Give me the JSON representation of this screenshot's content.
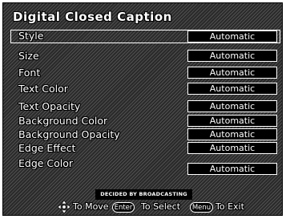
{
  "title": "Digital Closed Caption",
  "style_row": {
    "label": "Style",
    "value": "Automatic"
  },
  "settings": [
    {
      "label": "Size",
      "value": "Automatic"
    },
    {
      "label": "Font",
      "value": "Automatic"
    },
    {
      "label": "Text Color",
      "value": "Automatic"
    },
    {
      "label": "Text Opacity",
      "value": "Automatic"
    },
    {
      "label": "Background Color",
      "value": "Automatic"
    },
    {
      "label": "Background Opacity",
      "value": "Automatic"
    },
    {
      "label": "Edge Effect",
      "value": "Automatic"
    },
    {
      "label": "Edge Color",
      "value": "Automatic"
    }
  ],
  "notice": "DECIDED BY BROADCASTING",
  "footer": {
    "move_icon": "four-way-arrow-icon",
    "move_label": "To Move",
    "enter_key": "Enter",
    "select_label": "To Select",
    "menu_key": "Menu",
    "exit_label": "To Exit"
  }
}
